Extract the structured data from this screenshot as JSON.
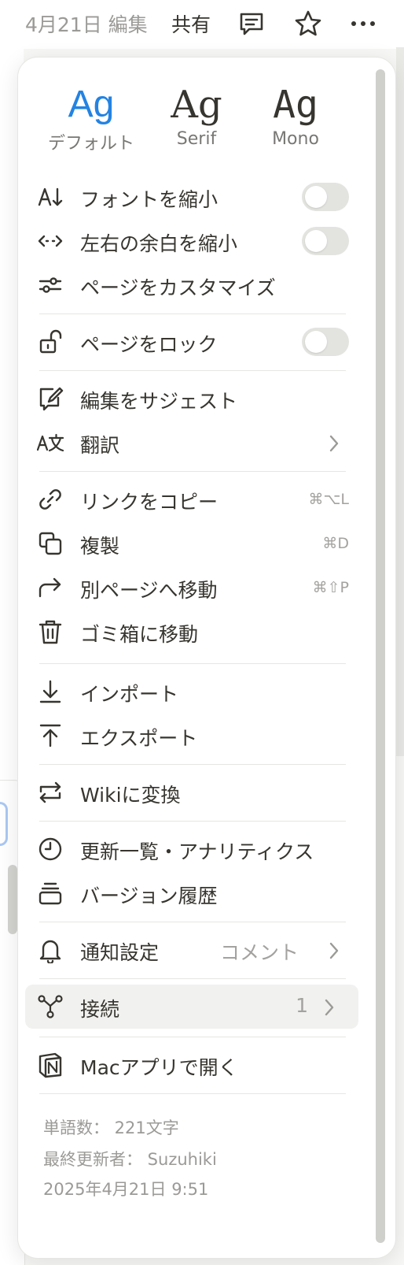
{
  "topbar": {
    "edited": "4月21日 編集",
    "share": "共有",
    "icons": [
      "comment-icon",
      "star-icon",
      "more-icon"
    ]
  },
  "font_options": [
    {
      "ag": "Ag",
      "label": "デフォルト",
      "selected": true
    },
    {
      "ag": "Ag",
      "label": "Serif",
      "selected": false
    },
    {
      "ag": "Ag",
      "label": "Mono",
      "selected": false
    }
  ],
  "menu": {
    "small_text": {
      "label": "フォントを縮小",
      "on": false
    },
    "full_width": {
      "label": "左右の余白を縮小",
      "on": false
    },
    "customize": {
      "label": "ページをカスタマイズ"
    },
    "lock": {
      "label": "ページをロック",
      "on": false
    },
    "suggest": {
      "label": "編集をサジェスト"
    },
    "translate": {
      "label": "翻訳"
    },
    "copy_link": {
      "label": "リンクをコピー",
      "shortcut": "⌘⌥L"
    },
    "duplicate": {
      "label": "複製",
      "shortcut": "⌘D"
    },
    "move_to": {
      "label": "別ページへ移動",
      "shortcut": "⌘⇧P"
    },
    "trash": {
      "label": "ゴミ箱に移動"
    },
    "import": {
      "label": "インポート"
    },
    "export": {
      "label": "エクスポート"
    },
    "wiki": {
      "label": "Wikiに変換"
    },
    "analytics": {
      "label": "更新一覧・アナリティクス"
    },
    "history": {
      "label": "バージョン履歴"
    },
    "notify": {
      "label": "通知設定",
      "value": "コメント"
    },
    "connections": {
      "label": "接続",
      "value": "1"
    },
    "mac_app": {
      "label": "Macアプリで開く"
    }
  },
  "footer": {
    "word_count": "単語数： 221文字",
    "last_edited_by": "最終更新者： Suzuhiki",
    "timestamp": "2025年4月21日 9:51"
  },
  "colors": {
    "accent": "#2383e2",
    "text": "#37352f",
    "muted": "#9b9a97",
    "toggle_off": "#e3e3e0"
  }
}
